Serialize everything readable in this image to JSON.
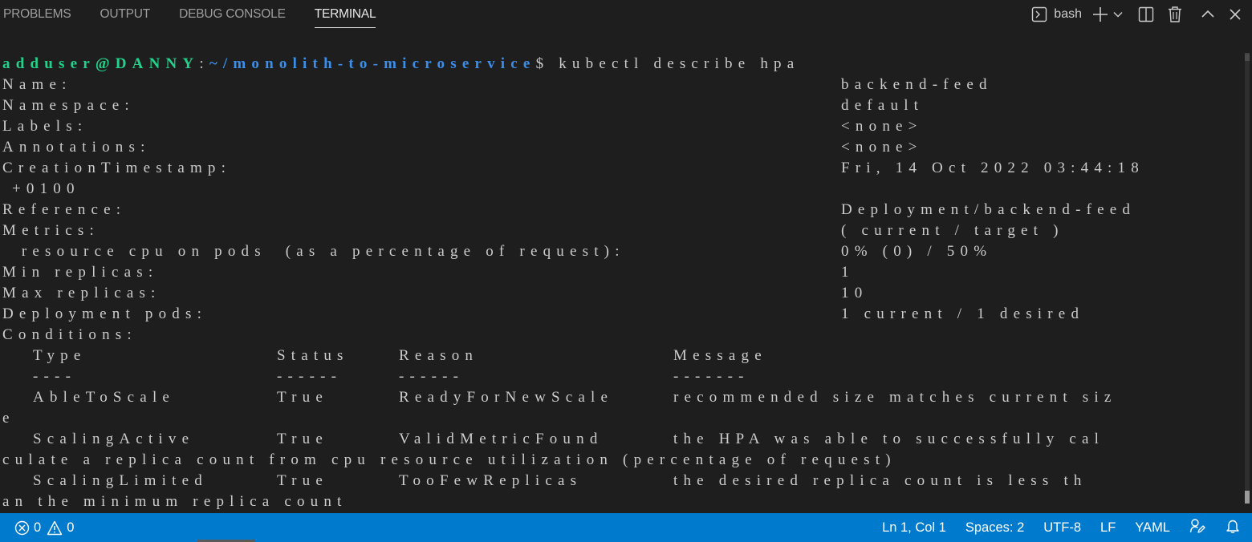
{
  "panel": {
    "tabs": [
      {
        "label": "PROBLEMS",
        "active": false
      },
      {
        "label": "OUTPUT",
        "active": false
      },
      {
        "label": "DEBUG CONSOLE",
        "active": false
      },
      {
        "label": "TERMINAL",
        "active": true
      }
    ],
    "actions": {
      "terminal_label": "bash",
      "icons": [
        "terminal-icon",
        "plus-icon",
        "chevron-down-icon",
        "split-icon",
        "trash-icon",
        "chevron-up-icon",
        "close-icon"
      ]
    }
  },
  "terminal": {
    "prompt": {
      "user_host": "adduser@DANNY",
      "colon": ":",
      "path": "~/monolith-to-microservice",
      "dollar": "$",
      "command": " kubectl describe hpa"
    },
    "fields": [
      {
        "label": "Name:",
        "value": "backend-feed"
      },
      {
        "label": "Namespace:",
        "value": "default"
      },
      {
        "label": "Labels:",
        "value": "<none>"
      },
      {
        "label": "Annotations:",
        "value": "<none>"
      },
      {
        "label": "CreationTimestamp:",
        "value": "Fri, 14 Oct 2022 03:44:18",
        "wrap": " +0100"
      },
      {
        "label": "Reference:",
        "value": "Deployment/backend-feed"
      },
      {
        "label": "Metrics:",
        "value": "( current / target )"
      },
      {
        "label": "  resource cpu on pods  (as a percentage of request):",
        "value": "0% (0) / 50%"
      },
      {
        "label": "Min replicas:",
        "value": "1"
      },
      {
        "label": "Max replicas:",
        "value": "10"
      },
      {
        "label": "Deployment pods:",
        "value": "1 current / 1 desired"
      }
    ],
    "conditions_label": "Conditions:",
    "conditions_header": [
      "Type",
      "Status",
      "Reason",
      "Message"
    ],
    "conditions_underline": [
      "----",
      "------",
      "------",
      "-------"
    ],
    "conditions": [
      {
        "type": "AbleToScale",
        "status": "True",
        "reason": "ReadyForNewScale",
        "message": "recommended size matches current siz",
        "message_cont": "e"
      },
      {
        "type": "ScalingActive",
        "status": "True",
        "reason": "ValidMetricFound",
        "message": "the HPA was able to successfully cal",
        "message_cont": "culate a replica count from cpu resource utilization (percentage of request)"
      },
      {
        "type": "ScalingLimited",
        "status": "True",
        "reason": "TooFewReplicas",
        "message": "the desired replica count is less th",
        "message_cont": "an the minimum replica count"
      }
    ]
  },
  "statusbar": {
    "errors": "0",
    "warnings": "0",
    "position": "Ln 1, Col 1",
    "spaces": "Spaces: 2",
    "encoding": "UTF-8",
    "eol": "LF",
    "language": "YAML"
  }
}
